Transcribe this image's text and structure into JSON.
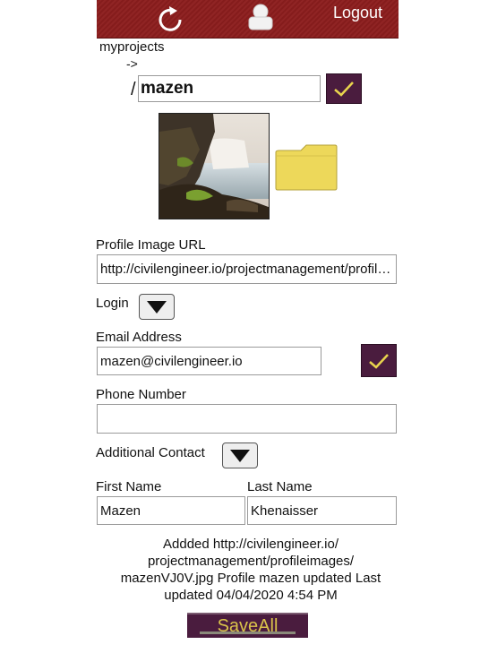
{
  "header": {
    "refresh_icon": "refresh-icon",
    "user_icon": "user-icon",
    "logout_label": "Logout",
    "bar_color": "#8c1d1d"
  },
  "breadcrumb": {
    "root": "myprojects",
    "arrow": "->",
    "slash": "/"
  },
  "project": {
    "name_value": "mazen",
    "confirm_icon": "checkmark-icon",
    "folder_icon": "folder-icon"
  },
  "profile": {
    "image_url_label": "Profile Image URL",
    "image_url_value": "http://civilengineer.io/projectmanagement/profileimages/mazenVJ0V.jpg"
  },
  "login": {
    "label": "Login",
    "toggle_icon": "triangle-down-icon"
  },
  "email": {
    "label": "Email Address",
    "value": "mazen@civilengineer.io",
    "confirm_icon": "checkmark-icon"
  },
  "phone": {
    "label": "Phone Number",
    "value": ""
  },
  "additional_contact": {
    "label": "Additional Contact",
    "toggle_icon": "triangle-down-icon"
  },
  "name": {
    "first_label": "First Name",
    "first_value": "Mazen",
    "last_label": "Last Name",
    "last_value": "Khenaisser"
  },
  "status": {
    "line1": "Addded http://civilengineer.io/",
    "line2": "projectmanagement/profileimages/",
    "line3": "mazenVJ0V.jpg Profile  mazen updated Last",
    "line4": "updated 04/04/2020 4:54 PM"
  },
  "actions": {
    "save_all_label": "SaveAll",
    "accent_color": "#4a1c3e",
    "check_color": "#e8d44d"
  }
}
